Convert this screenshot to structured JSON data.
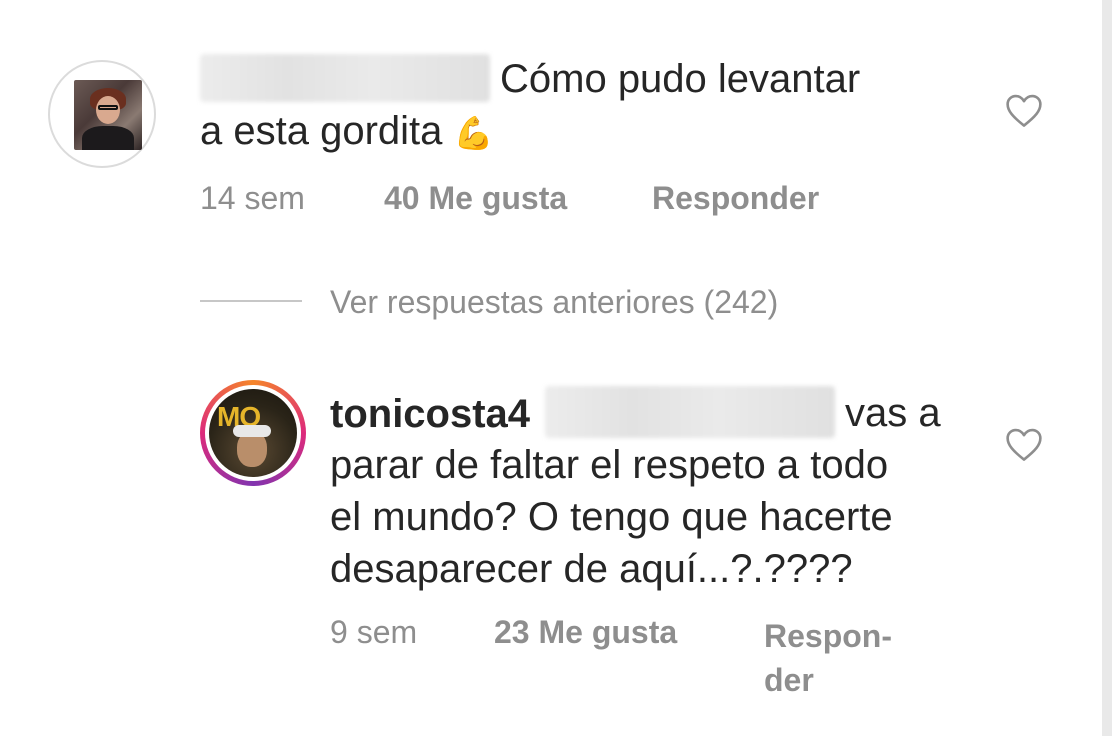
{
  "comment1": {
    "text_line1": "Cómo pudo levantar",
    "text_line2": "a esta gordita",
    "emoji": "💪",
    "time": "14 sem",
    "likes": "40 Me gusta",
    "reply": "Responder",
    "avatar_icon": "user-avatar-icon",
    "like_icon": "heart-icon"
  },
  "view_replies": {
    "label": "Ver respuestas anteriores (242)"
  },
  "comment2": {
    "username": "tonicosta4",
    "text_line1": "vas a",
    "text_line2": "parar de faltar el respeto a todo",
    "text_line3": "el mundo? O tengo que hacerte",
    "text_line4": "desaparecer de aquí...?.????",
    "avatar_text": "MQ",
    "time": "9 sem",
    "likes": "23 Me gusta",
    "reply_line1": "Respon-",
    "reply_line2": "der",
    "like_icon": "heart-icon"
  },
  "colors": {
    "text": "#262626",
    "meta": "#8e8e8e",
    "divider": "#c7c7c7"
  }
}
